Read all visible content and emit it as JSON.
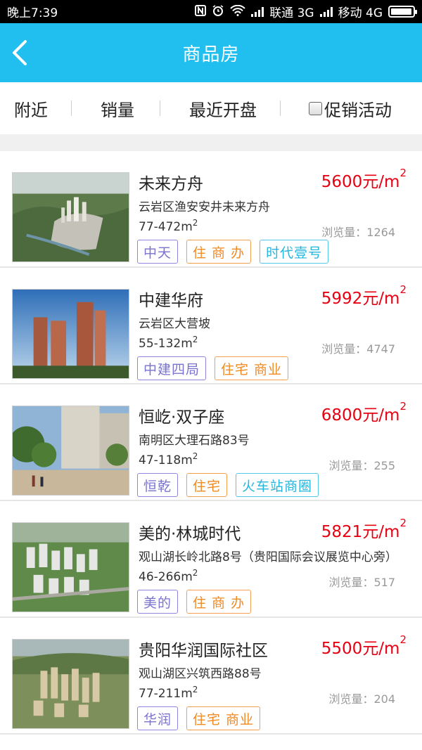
{
  "status_bar": {
    "time": "晚上7:39",
    "carrier1": "联通 3G",
    "carrier2": "移动 4G"
  },
  "header": {
    "title": "商品房"
  },
  "filters": {
    "nearby": "附近",
    "sales": "销量",
    "recent": "最近开盘",
    "promo": "促销活动"
  },
  "views_label": "浏览量：",
  "listings": [
    {
      "name": "未来方舟",
      "price": "5600元/m",
      "price_sup": "2",
      "address": "云岩区渔安安井未来方舟",
      "area": "77-472m",
      "area_sup": "2",
      "views": "1264",
      "tags": [
        {
          "text": "中天",
          "color": "purple"
        },
        {
          "text": "住 商 办",
          "color": "orange"
        },
        {
          "text": "时代壹号",
          "color": "cyan"
        }
      ],
      "thumb": "aerial-green"
    },
    {
      "name": "中建华府",
      "price": "5992元/m",
      "price_sup": "2",
      "address": "云岩区大营坡",
      "area": "55-132m",
      "area_sup": "2",
      "views": "4747",
      "tags": [
        {
          "text": "中建四局",
          "color": "purple"
        },
        {
          "text": "住宅 商业",
          "color": "orange"
        }
      ],
      "thumb": "towers-sky"
    },
    {
      "name": "恒屹·双子座",
      "price": "6800元/m",
      "price_sup": "2",
      "address": "南明区大理石路83号",
      "area": "47-118m",
      "area_sup": "2",
      "views": "255",
      "tags": [
        {
          "text": "恒乾",
          "color": "purple"
        },
        {
          "text": "住宅",
          "color": "orange"
        },
        {
          "text": "火车站商圈",
          "color": "cyan"
        }
      ],
      "thumb": "plaza-trees"
    },
    {
      "name": "美的·林城时代",
      "price": "5821元/m",
      "price_sup": "2",
      "address": "观山湖长岭北路8号（贵阳国际会议展览中心旁）",
      "area": "46-266m",
      "area_sup": "2",
      "views": "517",
      "tags": [
        {
          "text": "美的",
          "color": "purple"
        },
        {
          "text": "住 商 办",
          "color": "orange"
        }
      ],
      "thumb": "aerial-city"
    },
    {
      "name": "贵阳华润国际社区",
      "price": "5500元/m",
      "price_sup": "2",
      "address": "观山湖区兴筑西路88号",
      "area": "77-211m",
      "area_sup": "2",
      "views": "204",
      "tags": [
        {
          "text": "华润",
          "color": "purple"
        },
        {
          "text": "住宅 商业",
          "color": "orange"
        }
      ],
      "thumb": "aerial-hills"
    }
  ]
}
